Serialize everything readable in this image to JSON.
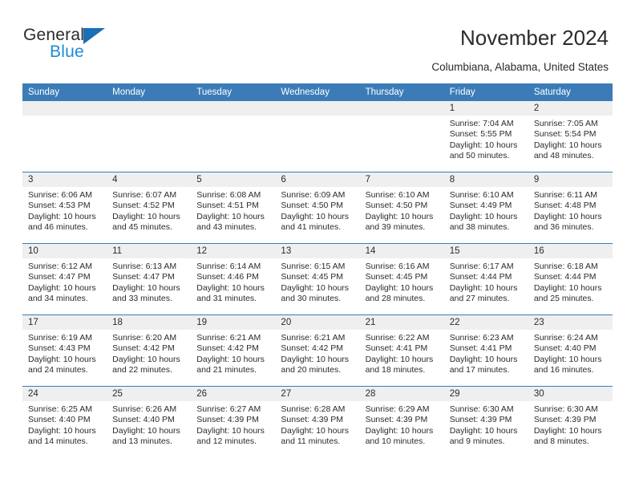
{
  "brand": {
    "name_top": "General",
    "name_bottom": "Blue",
    "accent_color": "#1e8bd8",
    "triangle_color": "#1a6fb5"
  },
  "header": {
    "title": "November 2024",
    "location": "Columbiana, Alabama, United States"
  },
  "calendar": {
    "header_bg": "#3b7cb8",
    "daynum_band_bg": "#efefef",
    "weekday_headers": [
      "Sunday",
      "Monday",
      "Tuesday",
      "Wednesday",
      "Thursday",
      "Friday",
      "Saturday"
    ],
    "labels": {
      "sunrise": "Sunrise:",
      "sunset": "Sunset:",
      "daylight": "Daylight:"
    },
    "weeks": [
      [
        {
          "day": "",
          "empty": true
        },
        {
          "day": "",
          "empty": true
        },
        {
          "day": "",
          "empty": true
        },
        {
          "day": "",
          "empty": true
        },
        {
          "day": "",
          "empty": true
        },
        {
          "day": "1",
          "sunrise": "Sunrise: 7:04 AM",
          "sunset": "Sunset: 5:55 PM",
          "daylight": "Daylight: 10 hours and 50 minutes."
        },
        {
          "day": "2",
          "sunrise": "Sunrise: 7:05 AM",
          "sunset": "Sunset: 5:54 PM",
          "daylight": "Daylight: 10 hours and 48 minutes."
        }
      ],
      [
        {
          "day": "3",
          "sunrise": "Sunrise: 6:06 AM",
          "sunset": "Sunset: 4:53 PM",
          "daylight": "Daylight: 10 hours and 46 minutes."
        },
        {
          "day": "4",
          "sunrise": "Sunrise: 6:07 AM",
          "sunset": "Sunset: 4:52 PM",
          "daylight": "Daylight: 10 hours and 45 minutes."
        },
        {
          "day": "5",
          "sunrise": "Sunrise: 6:08 AM",
          "sunset": "Sunset: 4:51 PM",
          "daylight": "Daylight: 10 hours and 43 minutes."
        },
        {
          "day": "6",
          "sunrise": "Sunrise: 6:09 AM",
          "sunset": "Sunset: 4:50 PM",
          "daylight": "Daylight: 10 hours and 41 minutes."
        },
        {
          "day": "7",
          "sunrise": "Sunrise: 6:10 AM",
          "sunset": "Sunset: 4:50 PM",
          "daylight": "Daylight: 10 hours and 39 minutes."
        },
        {
          "day": "8",
          "sunrise": "Sunrise: 6:10 AM",
          "sunset": "Sunset: 4:49 PM",
          "daylight": "Daylight: 10 hours and 38 minutes."
        },
        {
          "day": "9",
          "sunrise": "Sunrise: 6:11 AM",
          "sunset": "Sunset: 4:48 PM",
          "daylight": "Daylight: 10 hours and 36 minutes."
        }
      ],
      [
        {
          "day": "10",
          "sunrise": "Sunrise: 6:12 AM",
          "sunset": "Sunset: 4:47 PM",
          "daylight": "Daylight: 10 hours and 34 minutes."
        },
        {
          "day": "11",
          "sunrise": "Sunrise: 6:13 AM",
          "sunset": "Sunset: 4:47 PM",
          "daylight": "Daylight: 10 hours and 33 minutes."
        },
        {
          "day": "12",
          "sunrise": "Sunrise: 6:14 AM",
          "sunset": "Sunset: 4:46 PM",
          "daylight": "Daylight: 10 hours and 31 minutes."
        },
        {
          "day": "13",
          "sunrise": "Sunrise: 6:15 AM",
          "sunset": "Sunset: 4:45 PM",
          "daylight": "Daylight: 10 hours and 30 minutes."
        },
        {
          "day": "14",
          "sunrise": "Sunrise: 6:16 AM",
          "sunset": "Sunset: 4:45 PM",
          "daylight": "Daylight: 10 hours and 28 minutes."
        },
        {
          "day": "15",
          "sunrise": "Sunrise: 6:17 AM",
          "sunset": "Sunset: 4:44 PM",
          "daylight": "Daylight: 10 hours and 27 minutes."
        },
        {
          "day": "16",
          "sunrise": "Sunrise: 6:18 AM",
          "sunset": "Sunset: 4:44 PM",
          "daylight": "Daylight: 10 hours and 25 minutes."
        }
      ],
      [
        {
          "day": "17",
          "sunrise": "Sunrise: 6:19 AM",
          "sunset": "Sunset: 4:43 PM",
          "daylight": "Daylight: 10 hours and 24 minutes."
        },
        {
          "day": "18",
          "sunrise": "Sunrise: 6:20 AM",
          "sunset": "Sunset: 4:42 PM",
          "daylight": "Daylight: 10 hours and 22 minutes."
        },
        {
          "day": "19",
          "sunrise": "Sunrise: 6:21 AM",
          "sunset": "Sunset: 4:42 PM",
          "daylight": "Daylight: 10 hours and 21 minutes."
        },
        {
          "day": "20",
          "sunrise": "Sunrise: 6:21 AM",
          "sunset": "Sunset: 4:42 PM",
          "daylight": "Daylight: 10 hours and 20 minutes."
        },
        {
          "day": "21",
          "sunrise": "Sunrise: 6:22 AM",
          "sunset": "Sunset: 4:41 PM",
          "daylight": "Daylight: 10 hours and 18 minutes."
        },
        {
          "day": "22",
          "sunrise": "Sunrise: 6:23 AM",
          "sunset": "Sunset: 4:41 PM",
          "daylight": "Daylight: 10 hours and 17 minutes."
        },
        {
          "day": "23",
          "sunrise": "Sunrise: 6:24 AM",
          "sunset": "Sunset: 4:40 PM",
          "daylight": "Daylight: 10 hours and 16 minutes."
        }
      ],
      [
        {
          "day": "24",
          "sunrise": "Sunrise: 6:25 AM",
          "sunset": "Sunset: 4:40 PM",
          "daylight": "Daylight: 10 hours and 14 minutes."
        },
        {
          "day": "25",
          "sunrise": "Sunrise: 6:26 AM",
          "sunset": "Sunset: 4:40 PM",
          "daylight": "Daylight: 10 hours and 13 minutes."
        },
        {
          "day": "26",
          "sunrise": "Sunrise: 6:27 AM",
          "sunset": "Sunset: 4:39 PM",
          "daylight": "Daylight: 10 hours and 12 minutes."
        },
        {
          "day": "27",
          "sunrise": "Sunrise: 6:28 AM",
          "sunset": "Sunset: 4:39 PM",
          "daylight": "Daylight: 10 hours and 11 minutes."
        },
        {
          "day": "28",
          "sunrise": "Sunrise: 6:29 AM",
          "sunset": "Sunset: 4:39 PM",
          "daylight": "Daylight: 10 hours and 10 minutes."
        },
        {
          "day": "29",
          "sunrise": "Sunrise: 6:30 AM",
          "sunset": "Sunset: 4:39 PM",
          "daylight": "Daylight: 10 hours and 9 minutes."
        },
        {
          "day": "30",
          "sunrise": "Sunrise: 6:30 AM",
          "sunset": "Sunset: 4:39 PM",
          "daylight": "Daylight: 10 hours and 8 minutes."
        }
      ]
    ]
  }
}
